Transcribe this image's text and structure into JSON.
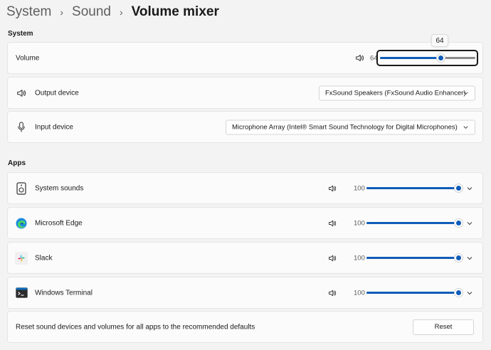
{
  "breadcrumb": {
    "items": [
      "System",
      "Sound"
    ],
    "current": "Volume mixer",
    "separator": "›"
  },
  "system_section": {
    "title": "System",
    "volume": {
      "label": "Volume",
      "value": 64,
      "value_display": "64",
      "tooltip": "64",
      "icon": "speaker-icon"
    },
    "output_device": {
      "label": "Output device",
      "selected": "FxSound Speakers (FxSound Audio Enhancer)",
      "icon": "speaker-icon"
    },
    "input_device": {
      "label": "Input device",
      "selected": "Microphone Array (Intel® Smart Sound Technology for Digital Microphones)",
      "icon": "microphone-icon"
    }
  },
  "apps_section": {
    "title": "Apps",
    "apps": [
      {
        "name": "System sounds",
        "volume": 100,
        "volume_display": "100",
        "icon": "system-sounds-icon"
      },
      {
        "name": "Microsoft Edge",
        "volume": 100,
        "volume_display": "100",
        "icon": "edge-icon"
      },
      {
        "name": "Slack",
        "volume": 100,
        "volume_display": "100",
        "icon": "slack-icon"
      },
      {
        "name": "Windows Terminal",
        "volume": 100,
        "volume_display": "100",
        "icon": "terminal-icon"
      }
    ]
  },
  "reset": {
    "description": "Reset sound devices and volumes for all apps to the recommended defaults",
    "button_label": "Reset"
  },
  "colors": {
    "accent": "#0f5cb8",
    "background": "#f3f3f3",
    "card": "#fbfbfb"
  }
}
